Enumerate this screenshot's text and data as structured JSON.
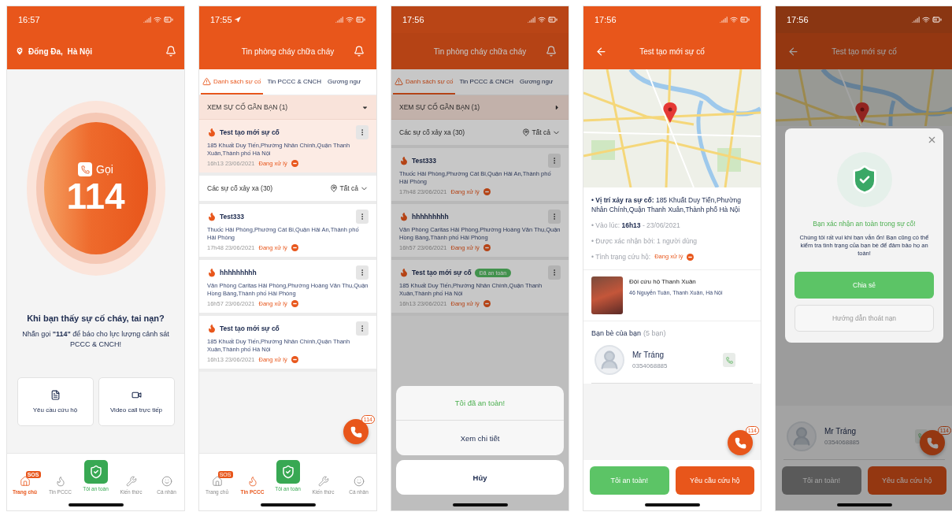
{
  "screens": [
    {
      "kind": "home",
      "status_time": "16:57",
      "location": "Đống Đa,  Hà Nội",
      "call": {
        "label": "Gọi",
        "number": "114"
      },
      "prompt_title": "Khi bạn thấy sự cố cháy, tai nạn?",
      "prompt_text": "Nhấn gọi **\"114\"** để báo cho lực lượng cảnh sát PCCC & CNCH!",
      "actions": [
        {
          "label": "Yêu cầu cứu hộ"
        },
        {
          "label": "Video call trực tiếp"
        }
      ],
      "nav": [
        {
          "label": "Trang chủ",
          "kind": "tab",
          "selected": true,
          "badge": "SOS"
        },
        {
          "label": "Tin PCCC",
          "kind": "tab",
          "selected": false
        },
        {
          "label": "Tôi an toàn",
          "kind": "center",
          "selected": false
        },
        {
          "label": "Kiến thức",
          "kind": "tab",
          "selected": false
        },
        {
          "label": "Cá nhân",
          "kind": "tab",
          "selected": false
        }
      ]
    },
    {
      "kind": "list",
      "status_time": "17:55",
      "location_arrow": true,
      "title": "Tin phòng cháy chữa cháy",
      "tabs": [
        {
          "label": "Danh sách sự cố",
          "selected": true
        },
        {
          "label": "Tin PCCC & CNCH",
          "selected": false
        },
        {
          "label": "Gương ngư",
          "selected": false
        }
      ],
      "nearby": {
        "title": "XEM SỰ CỐ GẦN BẠN (1)",
        "expanded": true,
        "items": [
          {
            "title": "Test tạo mới sự cố",
            "address": "185 Khuất Duy Tiến,Phường Nhân Chính,Quận Thanh Xuân,Thành phố Hà Nội",
            "time": "16h13 23/06/2021",
            "status": "Đang xử lý"
          }
        ]
      },
      "filter": {
        "label": "Các sự cố xảy xa (30)",
        "value": "Tất cả"
      },
      "incidents": [
        {
          "title": "Test333",
          "address": "Thuốc Hải Phòng,Phường Cát Bi,Quận Hải An,Thành phố Hải Phòng",
          "time": "17h48 23/06/2021",
          "status": "Đang xử lý"
        },
        {
          "title": "hhhhhhhhh",
          "address": "Văn Phòng Caritas Hải Phòng,Phường Hoàng Văn Thụ,Quận Hồng Bàng,Thành phố Hải Phòng",
          "time": "16h57 23/06/2021",
          "status": "Đang xử lý"
        },
        {
          "title": "Test tạo mới sự cố",
          "address": "185 Khuất Duy Tiến,Phường Nhân Chính,Quận Thanh Xuân,Thành phố Hà Nội",
          "time": "16h13 23/06/2021",
          "status": "Đang xử lý"
        }
      ],
      "fab": {
        "badge": "114"
      },
      "nav": [
        {
          "label": "Trang chủ",
          "kind": "tab",
          "selected": false,
          "badge": "SOS"
        },
        {
          "label": "Tin PCCC",
          "kind": "tab",
          "selected": true
        },
        {
          "label": "Tôi an toàn",
          "kind": "center",
          "selected": false
        },
        {
          "label": "Kiến thức",
          "kind": "tab",
          "selected": false
        },
        {
          "label": "Cá nhân",
          "kind": "tab",
          "selected": false
        }
      ]
    },
    {
      "kind": "list",
      "status_time": "17:56",
      "location_arrow": false,
      "title": "Tin phòng cháy chữa cháy",
      "tabs": [
        {
          "label": "Danh sách sự cố",
          "selected": true
        },
        {
          "label": "Tin PCCC & CNCH",
          "selected": false
        },
        {
          "label": "Gương ngư",
          "selected": false
        }
      ],
      "nearby": {
        "title": "XEM SỰ CỐ GẦN BẠN (1)",
        "expanded": false
      },
      "filter": {
        "label": "Các sự cố xảy xa (30)",
        "value": "Tất cả"
      },
      "incidents": [
        {
          "title": "Test333",
          "address": "Thuốc Hải Phòng,Phường Cát Bi,Quận Hải An,Thành phố Hải Phòng",
          "time": "17h48 23/06/2021",
          "status": "Đang xử lý"
        },
        {
          "title": "hhhhhhhhh",
          "address": "Văn Phòng Caritas Hải Phòng,Phường Hoàng Văn Thụ,Quận Hồng Bàng,Thành phố Hải Phòng",
          "time": "16h57 23/06/2021",
          "status": "Đang xử lý"
        },
        {
          "title": "Test tạo mới sự cố",
          "badge": "Đã an toàn",
          "address": "185 Khuất Duy Tiến,Phường Nhân Chính,Quận Thanh Xuân,Thành phố Hà Nội",
          "time": "16h13 23/06/2021",
          "status": "Đang xử lý"
        }
      ],
      "action_sheet": {
        "options": [
          {
            "label": "Tôi đã an toàn!",
            "kind": "safe"
          },
          {
            "label": "Xem chi tiết",
            "kind": "plain"
          }
        ],
        "cancel": "Hủy"
      }
    },
    {
      "kind": "detail",
      "status_time": "17:56",
      "title": "Test tạo mới sự cố",
      "details": [
        {
          "kind": "location",
          "text": "• **Vị trí xảy ra sự cố:** 185 Khuất Duy Tiến,Phường Nhân Chính,Quận Thanh Xuân,Thành phố Hà Nội"
        },
        {
          "kind": "info",
          "text": "• Vào lúc: **16h13** - 23/06/2021"
        },
        {
          "kind": "info",
          "text": "• Được xác nhận bởi: 1 người dùng"
        },
        {
          "kind": "status",
          "text": "• Tình trạng cứu hộ:",
          "status": "Đang xử lý"
        }
      ],
      "rescue_team": {
        "name": "Đội cứu hộ Thanh Xuân",
        "address": "46 Nguyễn Tuân, Thanh Xuân, Hà Nội"
      },
      "friends": {
        "title": "Bạn bè của bạn",
        "count": "(5 bạn)",
        "items": [
          {
            "name": "Mr Tráng",
            "phone": "0354068885"
          }
        ]
      },
      "fab": {
        "badge": "114"
      },
      "bottom_buttons": [
        {
          "label": "Tôi an toàn!",
          "kind": "safe",
          "disabled": false
        },
        {
          "label": "Yêu cầu cứu hộ",
          "kind": "rescue",
          "disabled": false
        }
      ]
    },
    {
      "kind": "detail",
      "status_time": "17:56",
      "title": "Test tạo mới sự cố",
      "friends": {
        "items": [
          {
            "name": "Mr Tráng",
            "phone": "0354068885"
          }
        ]
      },
      "fab": {
        "badge": "114"
      },
      "bottom_buttons": [
        {
          "label": "Tôi an toàn!",
          "kind": "safe",
          "disabled": true
        },
        {
          "label": "Yêu cầu cứu hộ",
          "kind": "rescue",
          "disabled": false
        }
      ],
      "modal": {
        "heading": "Bạn xác nhận an toàn trong sự cố!",
        "text": "Chúng tôi rất vui khi bạn vẫn ổn! Bạn cũng có thể kiểm tra tình trạng của bạn bè để đảm bảo họ an toàn!",
        "buttons": [
          {
            "label": "Chia sẻ",
            "kind": "primary"
          },
          {
            "label": "Hướng dẫn thoát nạn",
            "kind": "secondary"
          }
        ]
      }
    }
  ]
}
